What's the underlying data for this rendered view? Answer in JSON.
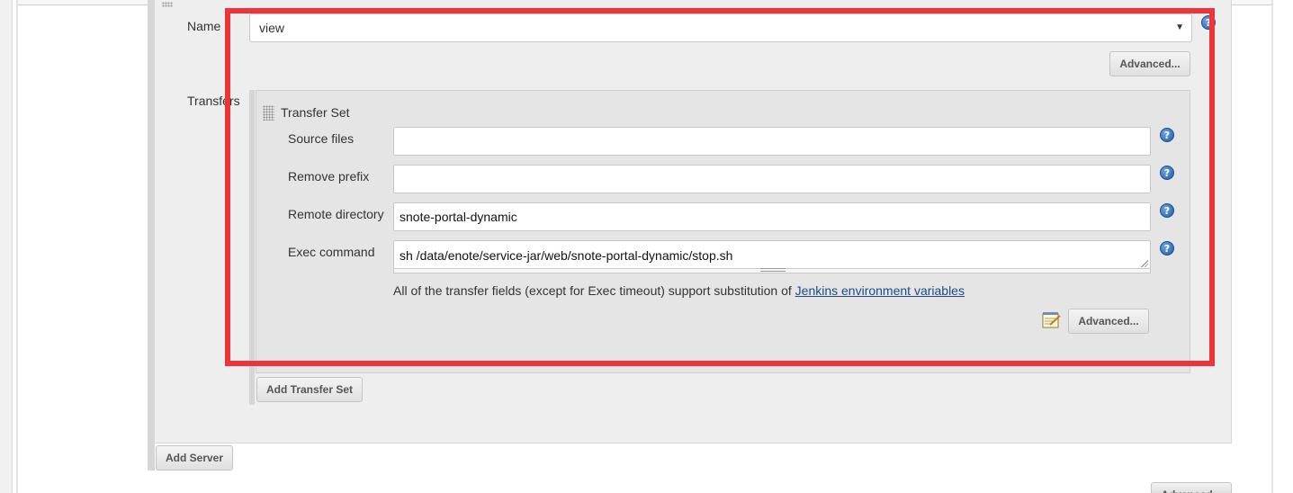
{
  "name_field": {
    "label": "Name",
    "value": "view",
    "help": "?"
  },
  "server_advanced_label": "Advanced...",
  "transfers_label": "Transfers",
  "transfer_set": {
    "title": "Transfer Set",
    "fields": {
      "source_files": {
        "label": "Source files",
        "value": ""
      },
      "remove_prefix": {
        "label": "Remove prefix",
        "value": ""
      },
      "remote_directory": {
        "label": "Remote directory",
        "value": "snote-portal-dynamic"
      },
      "exec_command": {
        "label": "Exec command",
        "value": "sh /data/enote/service-jar/web/snote-portal-dynamic/stop.sh"
      }
    },
    "help": "?",
    "note_text": "All of the transfer fields (except for Exec timeout) support substitution of ",
    "note_link": "Jenkins environment variables",
    "advanced_label": "Advanced..."
  },
  "add_transfer_set_label": "Add Transfer Set",
  "add_server_label": "Add Server",
  "bottom_advanced_label": "Advanced...",
  "colors": {
    "highlight_frame": "#f0333a",
    "link": "#204a87",
    "help_icon": "#1f5ea8"
  }
}
